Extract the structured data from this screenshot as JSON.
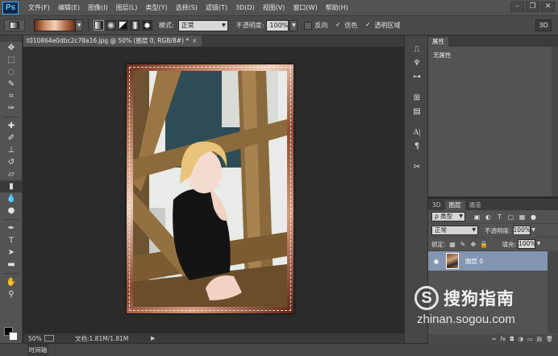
{
  "app": {
    "logo": "Ps"
  },
  "menu": [
    "文件(F)",
    "编辑(E)",
    "图像(I)",
    "图层(L)",
    "类型(Y)",
    "选择(S)",
    "滤镜(T)",
    "3D(D)",
    "视图(V)",
    "窗口(W)",
    "帮助(H)"
  ],
  "window_controls": {
    "minimize": "–",
    "restore": "❐",
    "close": "✕"
  },
  "options_bar": {
    "mode_label": "模式:",
    "mode_value": "正常",
    "opacity_label": "不透明度:",
    "opacity_value": "100%",
    "reverse_label": "反向",
    "dither_label": "仿色",
    "transparency_label": "透明区域",
    "reverse_checked": false,
    "dither_checked": true,
    "transparency_checked": true,
    "btn_3d": "3D",
    "gradient_colors": [
      "#6b2a17",
      "#c98a67",
      "#f2d2b9",
      "#b77352",
      "#6b2a17"
    ]
  },
  "document_tab": {
    "title": "t010864e0dbc2c78a16.jpg @ 50% (图层 0, RGB/8#) *",
    "close": "×"
  },
  "status_bar": {
    "zoom": "50%",
    "doc_info": "文档:1.81M/1.81M"
  },
  "timeline": {
    "label": "时间轴"
  },
  "properties_panel": {
    "tab": "属性",
    "content": "无属性"
  },
  "layers_panel": {
    "tabs": [
      "3D",
      "图层",
      "通道"
    ],
    "filter_label": "ρ 类型",
    "blend_mode": "正常",
    "opacity_label": "不透明度:",
    "opacity_value": "100%",
    "lock_label": "锁定:",
    "fill_label": "填充:",
    "fill_value": "100%",
    "layers": [
      {
        "name": "图层 0",
        "visible": true
      }
    ],
    "footer_icons": [
      "∞",
      "fx",
      "◘",
      "◑",
      "▭",
      "▤",
      "🗑"
    ]
  },
  "watermark": {
    "logo": "S",
    "name": "搜狗指南",
    "url": "zhinan.sogou.com"
  }
}
